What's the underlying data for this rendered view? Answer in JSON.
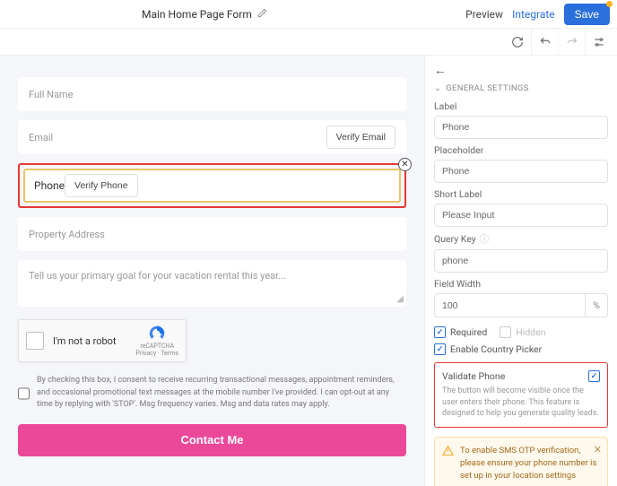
{
  "header": {
    "title": "Main Home Page Form",
    "preview": "Preview",
    "integrate": "Integrate",
    "save": "Save"
  },
  "form": {
    "fullName": "Full Name",
    "email": "Email",
    "verifyEmail": "Verify Email",
    "phone": "Phone",
    "verifyPhone": "Verify Phone",
    "address": "Property Address",
    "goal": "Tell us your primary goal for your vacation rental this year...",
    "recaptcha": "I'm not a robot",
    "recaptchaBrand": "reCAPTCHA",
    "recaptchaPrivacy": "Privacy · Terms",
    "consent": "By checking this box, I consent to receive recurring transactional messages, appointment reminders, and occasional promotional text messages at the mobile number I've provided. I can opt-out at any time by replying with 'STOP'. Msg frequency varies. Msg and data rates may apply.",
    "submit": "Contact Me"
  },
  "sidebar": {
    "sectionTitle": "GENERAL SETTINGS",
    "labels": {
      "label": "Label",
      "placeholder": "Placeholder",
      "shortLabel": "Short Label",
      "queryKey": "Query Key",
      "fieldWidth": "Field Width"
    },
    "values": {
      "label": "Phone",
      "placeholder": "Phone",
      "shortLabel": "Please Input",
      "queryKey": "phone",
      "fieldWidth": "100",
      "widthUnit": "%"
    },
    "checks": {
      "required": "Required",
      "hidden": "Hidden",
      "enableCountry": "Enable Country Picker"
    },
    "validate": {
      "title": "Validate Phone",
      "desc": "The button will become visible once the user enters their phone. This feature is designed to help you generate quality leads."
    },
    "alert": "To enable SMS OTP verification, please ensure your phone number is set up in your location settings"
  }
}
